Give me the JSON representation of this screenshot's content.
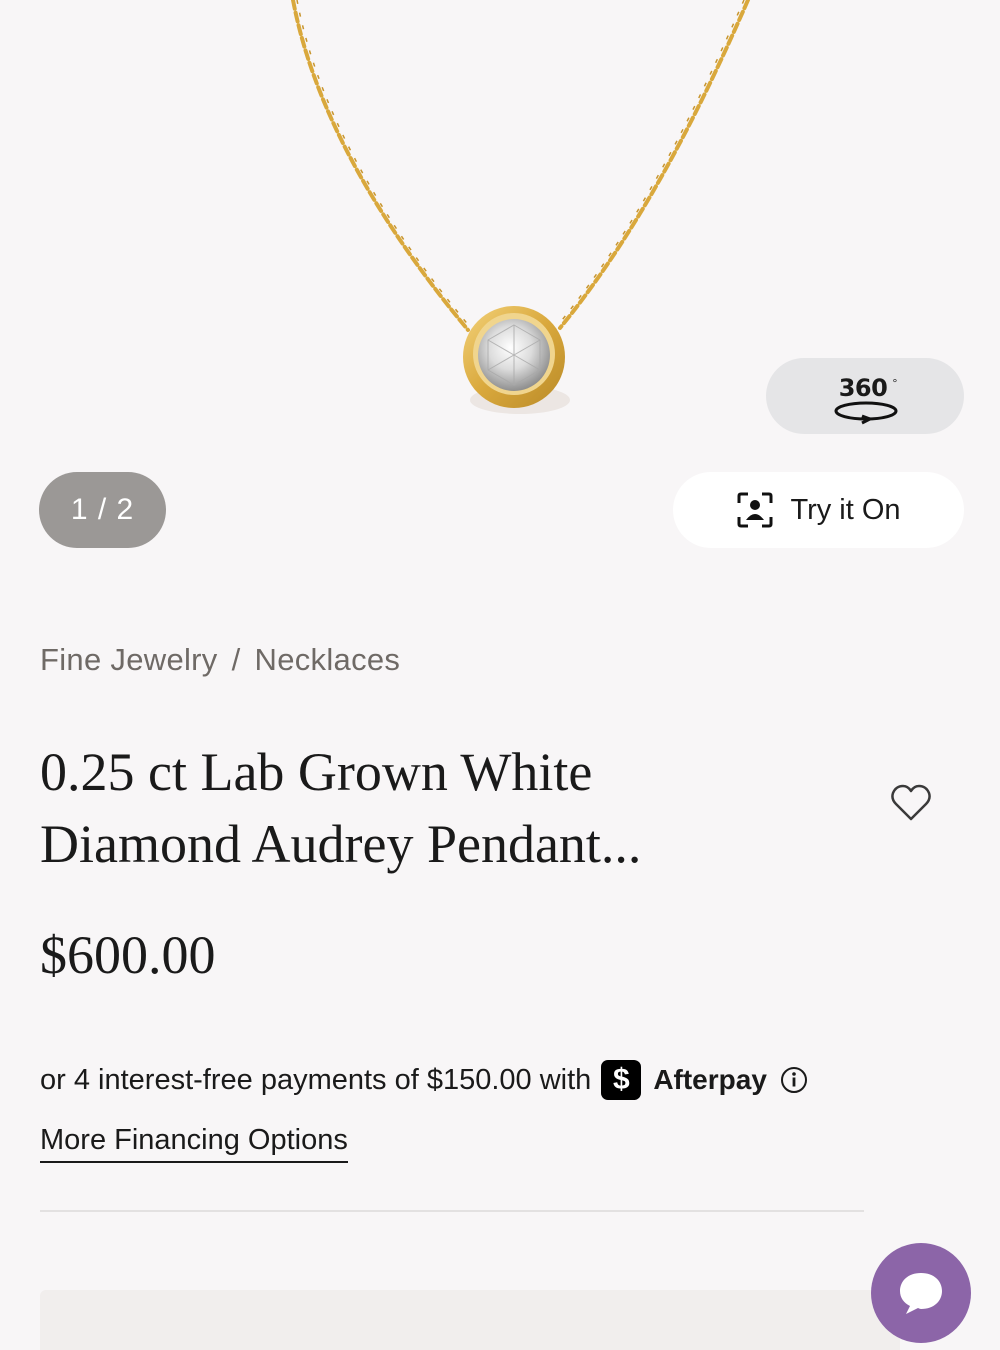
{
  "gallery": {
    "counter": "1 / 2",
    "view360_label": "360",
    "view360_degree": "°",
    "try_on_label": "Try it On"
  },
  "breadcrumb": {
    "level1": "Fine Jewelry",
    "separator": "/",
    "level2": "Necklaces"
  },
  "product": {
    "title_line1": "0.25 ct Lab Grown White",
    "title_line2": "Diamond Audrey Pendant...",
    "price": "$600.00"
  },
  "financing": {
    "afterpay_text": "or 4 interest-free payments of $150.00 with",
    "afterpay_logo_glyph": "$",
    "afterpay_name": "Afterpay",
    "more_options_label": "More Financing Options"
  },
  "colors": {
    "background": "#f8f6f7",
    "chain_gold": "#d9a83c",
    "counter_pill": "#9b9896",
    "chat_purple": "#8c65a8"
  },
  "icons": {
    "try_on": "face-scan-icon",
    "wishlist": "heart-icon",
    "info": "info-icon",
    "chat": "chat-bubble-icon",
    "rotate": "rotate-360-icon"
  }
}
